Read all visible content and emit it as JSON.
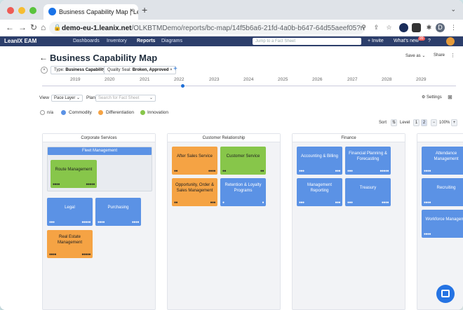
{
  "browser": {
    "tab_title": "Business Capability Map | Lea",
    "tab_close": "×",
    "new_tab": "+",
    "tab_dropdown": "⌄",
    "url_domain": "demo-eu-1.leanix.net",
    "url_path": "/OLKBTMDemo/reports/bc-map/14f5b6a6-21fd-4a0b-b647-64d55aeef05?returnUrl=%2...",
    "profile_initial": "D",
    "menu": "⋮"
  },
  "app": {
    "logo": "LeanIX EAM",
    "nav": [
      "Dashboards",
      "Inventory",
      "Reports",
      "Diagrams"
    ],
    "search_placeholder": "Jump to a Fact Sheet",
    "invite": "+ Invite",
    "whats_new": "What's new",
    "badge": "99",
    "help": "?"
  },
  "report": {
    "back": "←",
    "title": "Business Capability Map",
    "save_as": "Save as ⌄",
    "share": "Share",
    "more": "⋮",
    "filters": [
      {
        "label": "Type:",
        "value": "Business Capability"
      },
      {
        "label": "Quality Seal:",
        "value": "Broken, Approved"
      }
    ],
    "filter_remove": "×",
    "add_filter": "+",
    "years": [
      "2019",
      "2020",
      "2021",
      "2022",
      "2023",
      "2024",
      "2025",
      "2026",
      "2027",
      "2028",
      "2029"
    ],
    "view_label": "View",
    "view_value": "Pace Layer ⌄",
    "plan_label": "Plan",
    "plan_placeholder": "Search for Fact Sheet",
    "plan_caret": "⌄",
    "settings": "⚙ Settings",
    "grid": "⊞",
    "legend": [
      {
        "label": "n/a",
        "color": "#ffffff"
      },
      {
        "label": "Commodity",
        "color": "#5b92e5"
      },
      {
        "label": "Differentiation",
        "color": "#f5a344"
      },
      {
        "label": "Innovation",
        "color": "#87c64a"
      }
    ],
    "sort_label": "Sort",
    "sort_icon": "⇅",
    "level_label": "Level",
    "levels": [
      "1",
      "2"
    ],
    "zoom_minus": "−",
    "zoom": "100%",
    "zoom_plus": "+"
  },
  "columns": [
    {
      "title": "Corporate Services"
    },
    {
      "title": "Customer Relationship"
    },
    {
      "title": "Finance"
    },
    {
      "title": ""
    }
  ],
  "cards": {
    "fleet": "Fleet Management",
    "route": "Route Management",
    "legal": "Legal",
    "purchasing": "Purchasing",
    "real_estate": "Real Estate Management",
    "after_sales": "After Sales Service",
    "customer_service": "Customer Service",
    "opportunity": "Opportunity, Order & Sales Management",
    "retention": "Retention & Loyalty Programs",
    "accounting": "Accounting & Billing",
    "financial_planning": "Financial Planning & Forecasting",
    "mgmt_reporting": "Management Reporting",
    "treasury": "Treasury",
    "attendance": "Attendance Management",
    "recruiting": "Recruiting",
    "workforce": "Workforce Manageme"
  },
  "pips": {
    "left4": "●●●●",
    "left3": "●●●",
    "left2": "●●",
    "left1": "●",
    "right5": "●●●●●",
    "right4": "●●●●",
    "right3": "●●●",
    "right2": "●●",
    "right1": "●"
  },
  "chat_label": ""
}
